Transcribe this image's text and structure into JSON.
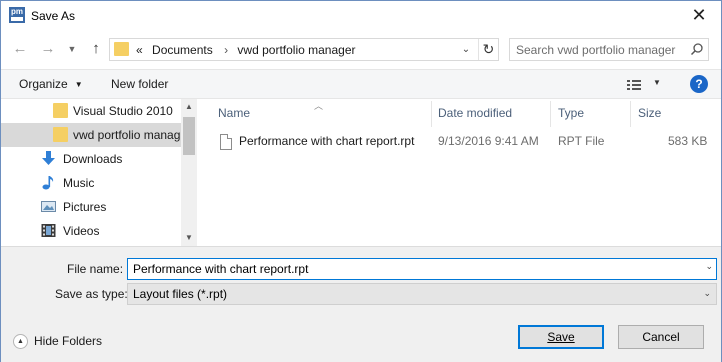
{
  "window": {
    "title": "Save As",
    "app_icon_text": "pm"
  },
  "nav": {
    "address_crumbs": [
      "«",
      "Documents",
      "›",
      "vwd portfolio manager"
    ],
    "search_placeholder": "Search vwd portfolio manager"
  },
  "toolbar": {
    "organize_label": "Organize",
    "new_folder_label": "New folder",
    "help_label": "?"
  },
  "sidebar": {
    "items": [
      {
        "label": "Visual Studio 2010",
        "icon": "folder-icon"
      },
      {
        "label": "vwd portfolio manag",
        "icon": "folder-icon",
        "selected": true
      },
      {
        "label": "Downloads",
        "icon": "downloads-icon"
      },
      {
        "label": "Music",
        "icon": "music-icon"
      },
      {
        "label": "Pictures",
        "icon": "pictures-icon"
      },
      {
        "label": "Videos",
        "icon": "videos-icon"
      }
    ]
  },
  "file_list": {
    "columns": [
      "Name",
      "Date modified",
      "Type",
      "Size"
    ],
    "rows": [
      {
        "name": "Performance with chart report.rpt",
        "date_modified": "9/13/2016 9:41 AM",
        "type": "RPT File",
        "size": "583 KB"
      }
    ]
  },
  "form": {
    "file_name_label": "File name:",
    "file_name_value": "Performance with chart report.rpt",
    "save_as_type_label": "Save as type:",
    "save_as_type_value": "Layout files (*.rpt)",
    "hide_folders_label": "Hide Folders",
    "save_label": "Save",
    "cancel_label": "Cancel"
  },
  "colors": {
    "accent": "#0078d7",
    "folder": "#f5cf63",
    "help": "#1a66c7"
  }
}
